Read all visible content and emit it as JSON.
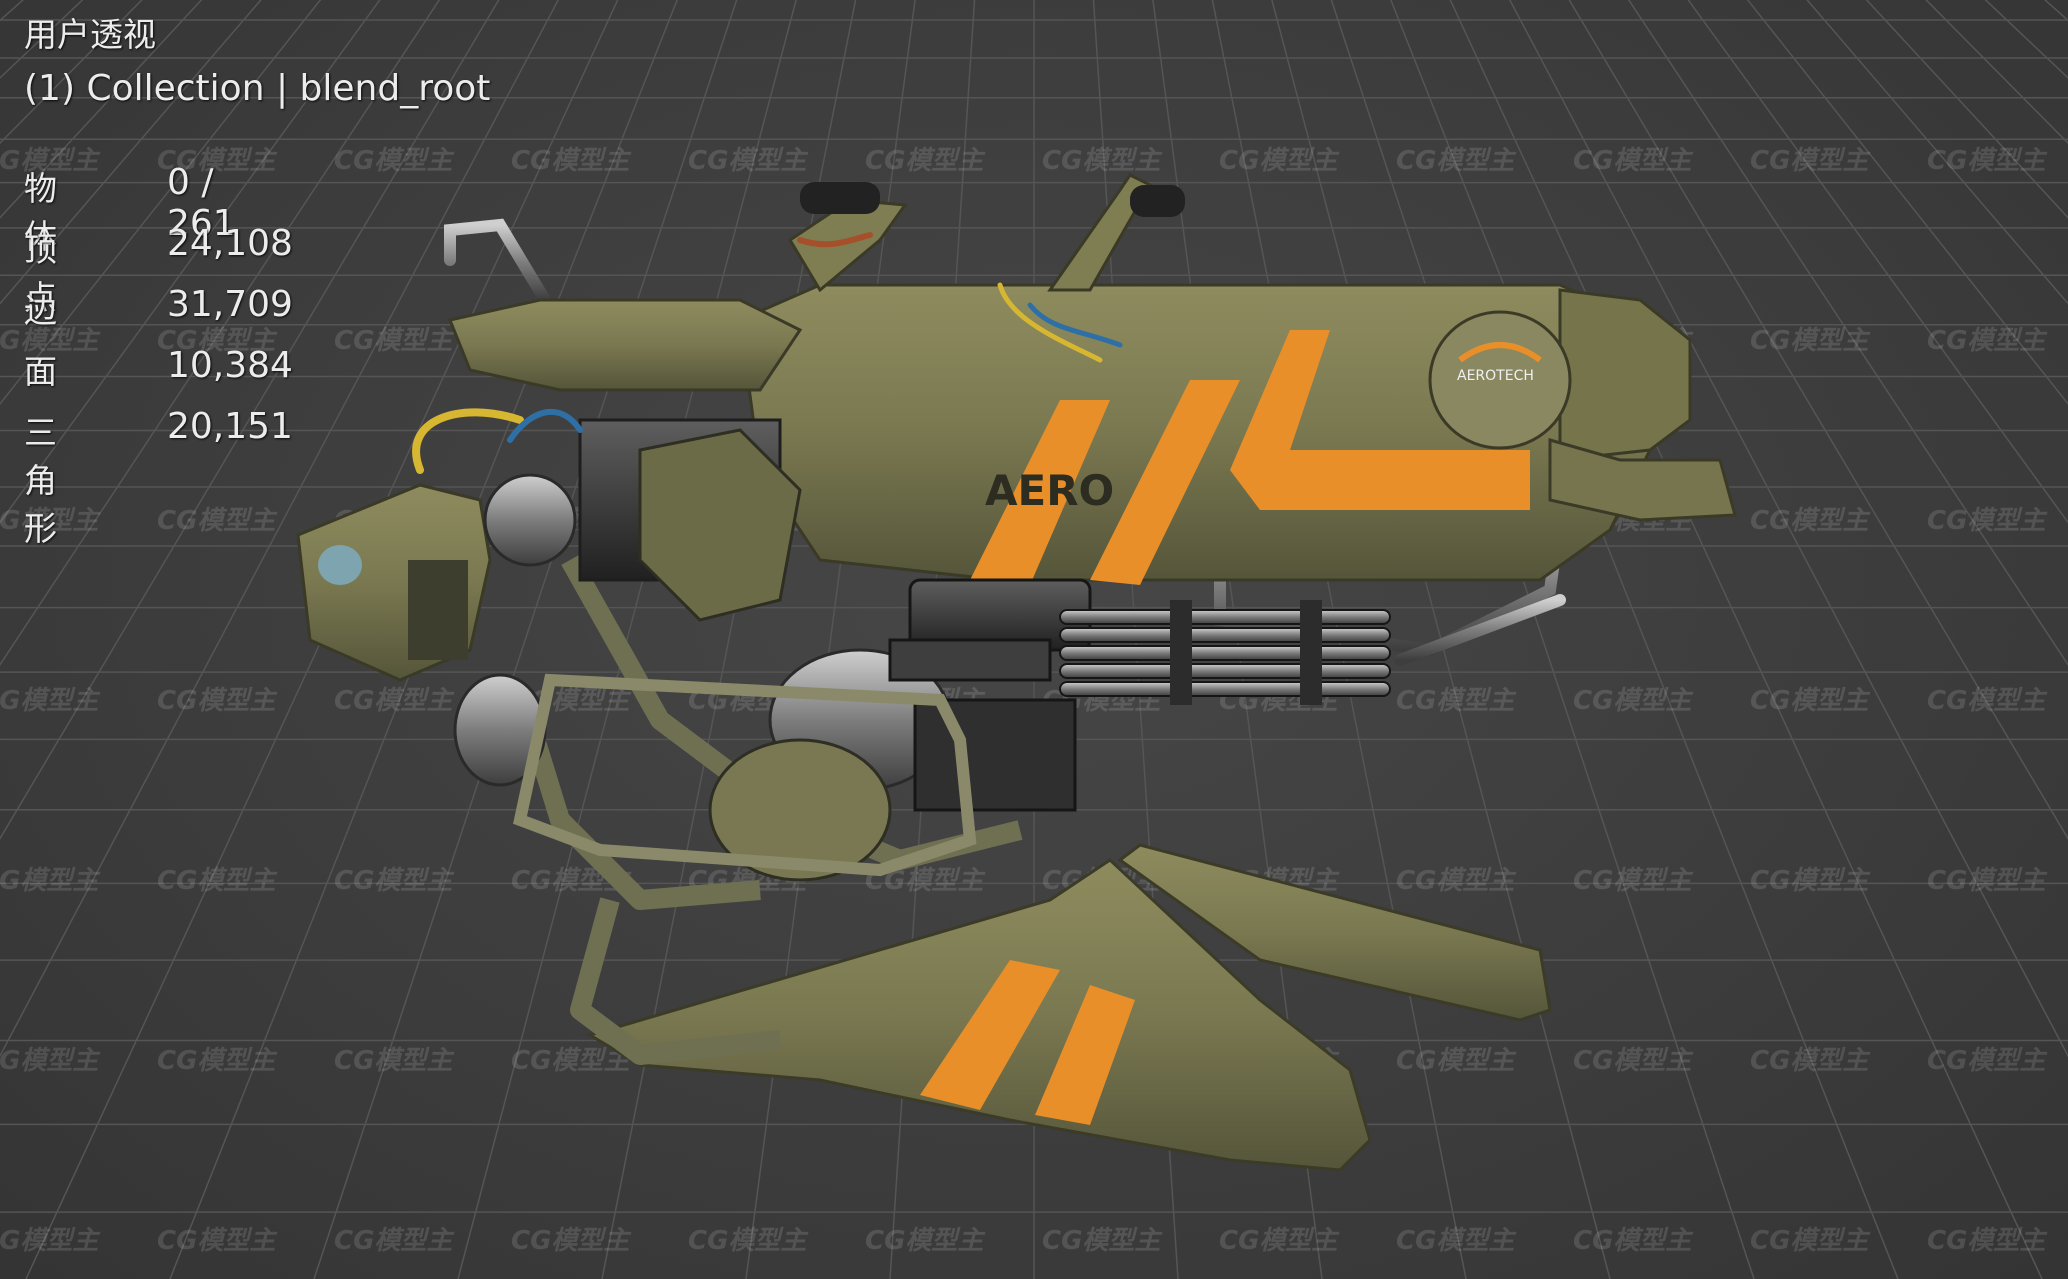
{
  "viewport": {
    "view_mode": "用户透视",
    "collection": "(1) Collection | blend_root",
    "background_color": "#3d3d3d",
    "grid_color": "#555555"
  },
  "stats": [
    {
      "label": "物体",
      "value": "0 / 261"
    },
    {
      "label": "顶点",
      "value": "24,108"
    },
    {
      "label": "边",
      "value": "31,709"
    },
    {
      "label": "面",
      "value": "10,384"
    },
    {
      "label": "三角形",
      "value": "20,151"
    }
  ],
  "model": {
    "body_color": "#7b7a4e",
    "stripe_color": "#e98f2a",
    "decal_text": "AERO",
    "emblem_text": "AEROTECH"
  },
  "watermark": {
    "text": "CG模型主"
  }
}
